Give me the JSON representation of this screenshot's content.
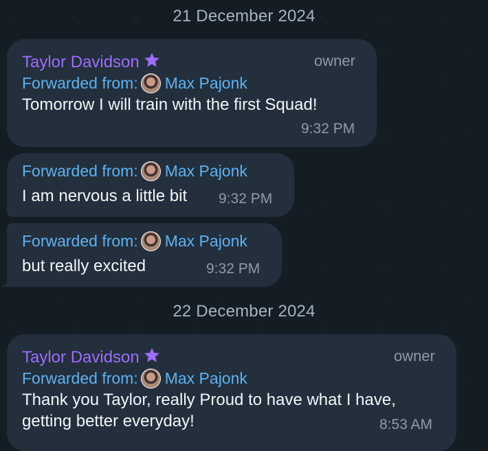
{
  "dates": [
    "21 December 2024",
    "22 December 2024"
  ],
  "messages": [
    {
      "sender": "Taylor Davidson",
      "role": "owner",
      "forward_prefix": "Forwarded from:",
      "forward_name": "Max Pajonk",
      "text": "Tomorrow I will train with the first Squad!",
      "time": "9:32 PM"
    },
    {
      "forward_prefix": "Forwarded from:",
      "forward_name": "Max Pajonk",
      "text": "I am nervous a little bit",
      "time": "9:32 PM"
    },
    {
      "forward_prefix": "Forwarded from:",
      "forward_name": "Max Pajonk",
      "text": "but really excited",
      "time": "9:32 PM"
    },
    {
      "sender": "Taylor Davidson",
      "role": "owner",
      "forward_prefix": "Forwarded from:",
      "forward_name": "Max Pajonk",
      "text_lines": [
        "Thank you Taylor, really Proud to have what I have,",
        "getting better everyday!"
      ],
      "time": "8:53 AM"
    }
  ],
  "colors": {
    "background": "#141c24",
    "bubble": "#232f3c",
    "sender": "#9d6dff",
    "forward": "#5fb2f2",
    "meta": "#8f9baa"
  },
  "icons": {
    "star": "premium-star-icon",
    "avatar": "forward-avatar"
  }
}
